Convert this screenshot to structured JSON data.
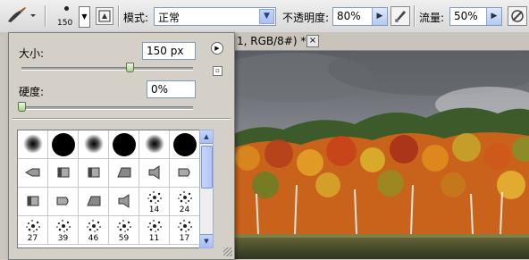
{
  "options_bar": {
    "brush_size": "150",
    "mode_label": "模式:",
    "mode_value": "正常",
    "opacity_label": "不透明度:",
    "opacity_value": "80%",
    "flow_label": "流量:",
    "flow_value": "50%"
  },
  "document": {
    "tab_title": "1, RGB/8#) *",
    "close_glyph": "×"
  },
  "brush_panel": {
    "size_label": "大小:",
    "size_value": "150 px",
    "size_fraction": 0.63,
    "hardness_label": "硬度:",
    "hardness_value": "0%",
    "hardness_fraction": 0.0,
    "presets": [
      {
        "kind": "soft",
        "label": ""
      },
      {
        "kind": "hard",
        "label": ""
      },
      {
        "kind": "soft",
        "label": ""
      },
      {
        "kind": "hard",
        "label": ""
      },
      {
        "kind": "soft",
        "label": ""
      },
      {
        "kind": "hard",
        "label": ""
      },
      {
        "kind": "tip1",
        "label": ""
      },
      {
        "kind": "tip2",
        "label": ""
      },
      {
        "kind": "tip2",
        "label": ""
      },
      {
        "kind": "tip3",
        "label": ""
      },
      {
        "kind": "tip4",
        "label": ""
      },
      {
        "kind": "tip5",
        "label": ""
      },
      {
        "kind": "tip2",
        "label": ""
      },
      {
        "kind": "tip5",
        "label": ""
      },
      {
        "kind": "tip3",
        "label": ""
      },
      {
        "kind": "tip4",
        "label": ""
      },
      {
        "kind": "spray",
        "label": "14"
      },
      {
        "kind": "spray",
        "label": "24"
      },
      {
        "kind": "spray",
        "label": "27"
      },
      {
        "kind": "spray",
        "label": "39"
      },
      {
        "kind": "spray",
        "label": "46"
      },
      {
        "kind": "spray",
        "label": "59"
      },
      {
        "kind": "spray",
        "label": "11"
      },
      {
        "kind": "spray",
        "label": "17"
      }
    ]
  },
  "colors": {
    "panel_bg": "#d4d0c8",
    "accent_blue": "#a9c0f1",
    "slider_green": "#4d7d38"
  }
}
